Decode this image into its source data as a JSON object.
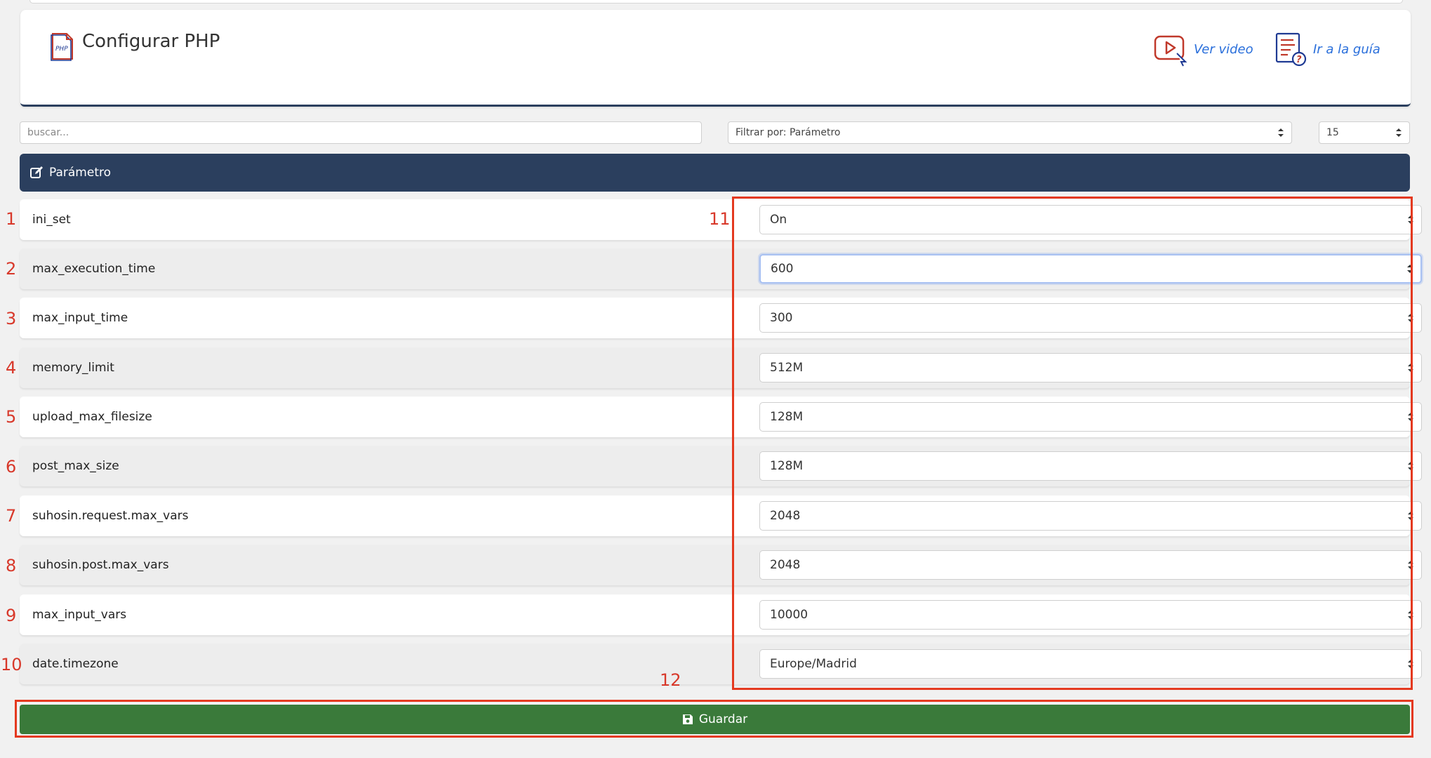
{
  "page": {
    "title": "Configurar PHP",
    "links": {
      "video": "Ver video",
      "guide": "Ir a la guía"
    }
  },
  "toolbar": {
    "search_placeholder": "buscar...",
    "filter_value": "Filtrar por: Parámetro",
    "count_value": "15"
  },
  "table": {
    "header": "Parámetro",
    "rows": [
      {
        "param": "ini_set",
        "value": "On"
      },
      {
        "param": "max_execution_time",
        "value": "600"
      },
      {
        "param": "max_input_time",
        "value": "300"
      },
      {
        "param": "memory_limit",
        "value": "512M"
      },
      {
        "param": "upload_max_filesize",
        "value": "128M"
      },
      {
        "param": "post_max_size",
        "value": "128M"
      },
      {
        "param": "suhosin.request.max_vars",
        "value": "2048"
      },
      {
        "param": "suhosin.post.max_vars",
        "value": "2048"
      },
      {
        "param": "max_input_vars",
        "value": "10000"
      },
      {
        "param": "date.timezone",
        "value": "Europe/Madrid"
      }
    ]
  },
  "annotations": {
    "row_numbers": [
      "1",
      "2",
      "3",
      "4",
      "5",
      "6",
      "7",
      "8",
      "9",
      "10"
    ],
    "values_label": "11",
    "save_label": "12"
  },
  "actions": {
    "save": "Guardar"
  },
  "colors": {
    "header_bar": "#2b3f5e",
    "save_button": "#3a7a3a",
    "link": "#2a6fdb",
    "annotation": "#e4391f"
  }
}
